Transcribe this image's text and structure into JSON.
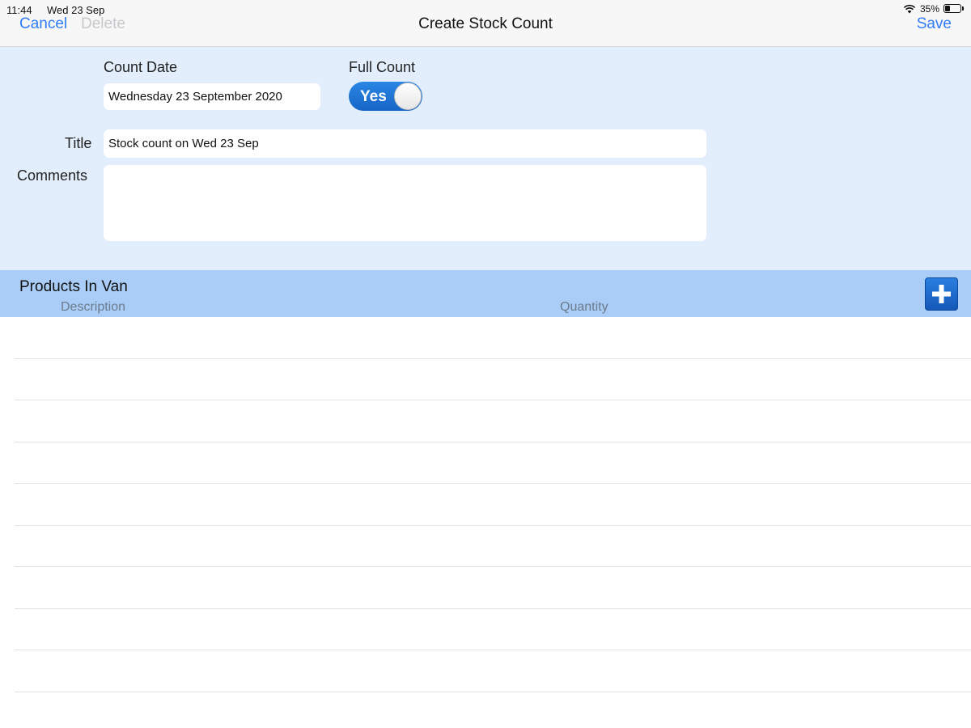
{
  "status_bar": {
    "time": "11:44",
    "date": "Wed 23 Sep",
    "battery_percent": "35%",
    "battery_level": 0.35,
    "icons": [
      "wifi-icon",
      "battery-icon"
    ]
  },
  "nav": {
    "cancel_label": "Cancel",
    "delete_label": "Delete",
    "title": "Create Stock Count",
    "save_label": "Save",
    "accent_color": "#2f7cf6",
    "disabled_color": "#c8c8cc"
  },
  "form": {
    "count_date_label": "Count Date",
    "count_date_value": "Wednesday 23 September 2020",
    "full_count_label": "Full Count",
    "full_count_value": "Yes",
    "full_count_on": true,
    "title_label": "Title",
    "title_value": "Stock count on Wed 23 Sep",
    "comments_label": "Comments",
    "comments_value": "",
    "background_color": "#e2eefc"
  },
  "products": {
    "section_title": "Products In Van",
    "columns": [
      "Description",
      "Quantity"
    ],
    "add_icon": "plus-icon",
    "rows": [],
    "header_color": "#a9cdf7"
  }
}
